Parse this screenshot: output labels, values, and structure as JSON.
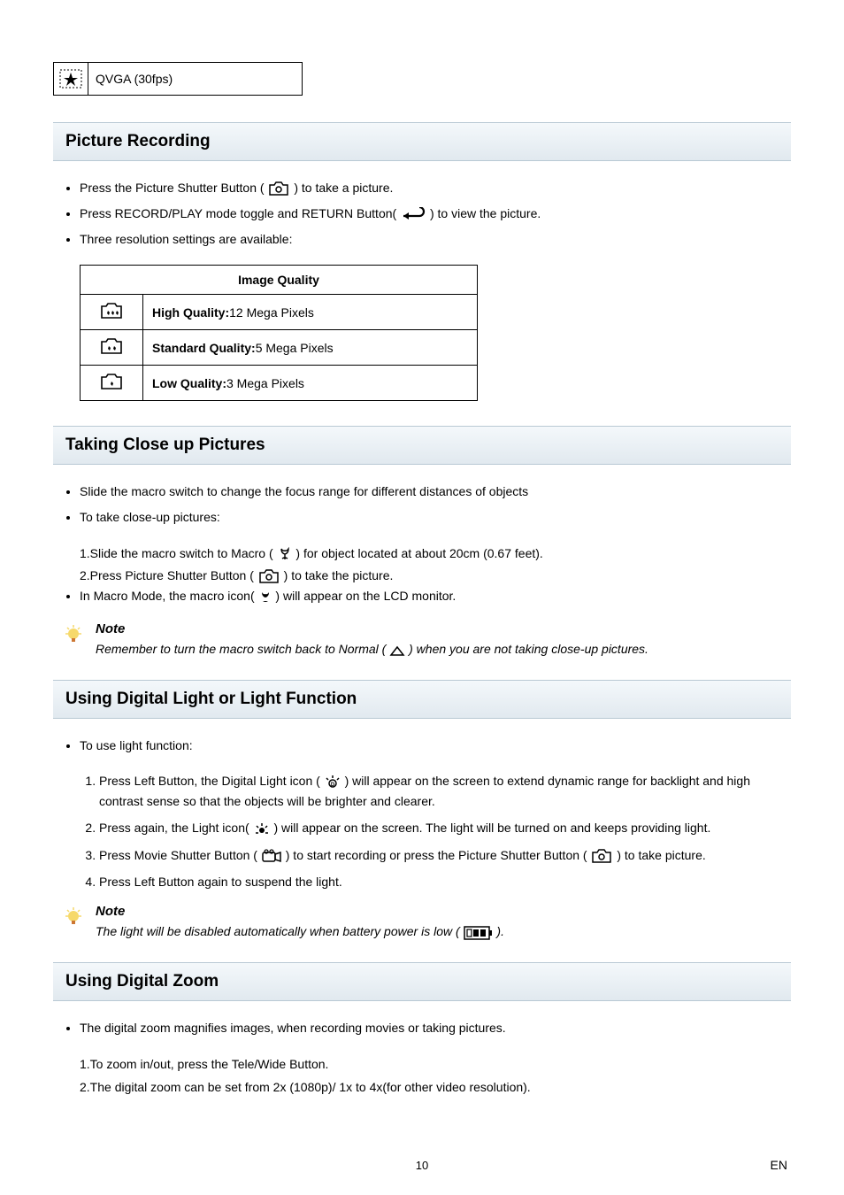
{
  "qvga_label": "QVGA (30fps)",
  "sections": {
    "picture_recording": {
      "title": "Picture Recording",
      "bullet1_a": "Press the Picture Shutter Button ( ",
      "bullet1_b": " ) to take a picture.",
      "bullet2_a": "Press RECORD/PLAY mode toggle and RETURN Button( ",
      "bullet2_b": " ) to view the picture.",
      "bullet3": "Three resolution settings are available:",
      "table_header": "Image Quality",
      "row1_label": "High Quality:",
      "row1_val": "12 Mega Pixels",
      "row2_label": "Standard Quality:",
      "row2_val": "5 Mega Pixels",
      "row3_label": "Low Quality:",
      "row3_val": "3 Mega Pixels"
    },
    "closeup": {
      "title": "Taking Close up Pictures",
      "bullet1": "Slide the macro switch to change the focus range for different distances of objects",
      "bullet2": "To take close-up pictures:",
      "step1_a": "1.Slide the macro switch to Macro (",
      "step1_b": ") for object located at about 20cm (0.67 feet).",
      "step2_a": "2.Press Picture Shutter Button ( ",
      "step2_b": " ) to take the picture.",
      "bullet3_a": "In Macro Mode, the macro icon(",
      "bullet3_b": ") will appear on the LCD monitor.",
      "note_title": "Note",
      "note_text_a": "Remember to turn the macro switch back to Normal ( ",
      "note_text_b": " ) when you are not taking close-up pictures."
    },
    "light": {
      "title": "Using Digital Light or Light Function",
      "bullet1": "To use light function:",
      "step1_a": "Press Left Button, the Digital Light icon (",
      "step1_b": ") will appear on the screen to extend dynamic range for backlight and high contrast sense so that the objects will be brighter and clearer.",
      "step2_a": "Press again, the Light icon( ",
      "step2_b": " ) will appear on the screen. The light will be turned on and keeps providing light.",
      "step3_a": "Press Movie Shutter Button ( ",
      "step3_b": " ) to start recording or press the Picture Shutter Button ( ",
      "step3_c": " ) to take picture.",
      "step4": "Press Left Button again to suspend the light.",
      "note_title": "Note",
      "note_text_a": "The light will be disabled automatically when battery power is low ( ",
      "note_text_b": " )."
    },
    "zoom": {
      "title": "Using Digital Zoom",
      "bullet1": "The digital zoom magnifies images, when recording movies or taking pictures.",
      "step1": "1.To zoom in/out, press the Tele/Wide Button.",
      "step2": "2.The digital zoom can be set from 2x (1080p)/  1x to 4x(for other video resolution)."
    }
  },
  "footer": {
    "page": "10",
    "lang": "EN"
  }
}
